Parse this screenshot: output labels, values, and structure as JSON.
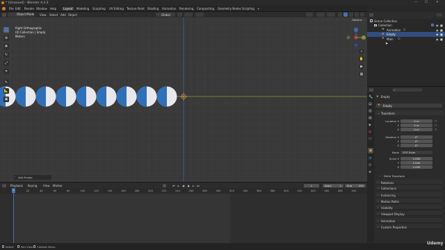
{
  "window": {
    "title": "* (Unsaved) - Blender 4.4.3"
  },
  "menus": [
    "File",
    "Edit",
    "Render",
    "Window",
    "Help"
  ],
  "workspaces": [
    "Layout",
    "Modeling",
    "Sculpting",
    "UV Editing",
    "Texture Paint",
    "Shading",
    "Animation",
    "Rendering",
    "Compositing",
    "Geometry Nodes",
    "Scripting"
  ],
  "active_workspace": "Layout",
  "scene": {
    "scene_name": "Scene",
    "view_layer": "ViewLayer"
  },
  "viewport_header": {
    "mode": "Object Mode",
    "menus": [
      "View",
      "Select",
      "Add",
      "Object"
    ],
    "orientation": "Global",
    "options_label": "Options"
  },
  "viewport_info": {
    "line1": "Right Orthographic",
    "line2": "(0) Collection | Empty",
    "line3": "Meters"
  },
  "last_operator": "Add Empty",
  "outliner": {
    "rows": [
      {
        "label": "Scene Collection",
        "level": 0
      },
      {
        "label": "Collection",
        "level": 1
      },
      {
        "label": "Animation",
        "level": 2
      },
      {
        "label": "Empty",
        "level": 2,
        "selected": true
      },
      {
        "label": "Main",
        "level": 2
      }
    ]
  },
  "properties": {
    "search_placeholder": "",
    "object_name": "Empty",
    "context_name": "Empty",
    "transform_title": "Transform",
    "location_label": "Location X",
    "rotation_label": "Rotation X",
    "scale_label": "Scale X",
    "y_label": "Y",
    "z_label": "Z",
    "location": [
      "0 m",
      "0 m",
      "0 m"
    ],
    "rotation": [
      "0°",
      "0°",
      "0°"
    ],
    "mode_label": "Mode",
    "mode_value": "XYZ Euler",
    "scale": [
      "1.000",
      "1.000",
      "1.000"
    ],
    "delta_label": "Delta Transform",
    "panels": [
      "Relations",
      "Collections",
      "Instancing",
      "Motion Paths",
      "Visibility",
      "Viewport Display",
      "Animation",
      "Custom Properties"
    ]
  },
  "timeline": {
    "menus": [
      "Playback",
      "Keying",
      "View",
      "Marker"
    ],
    "current_frame": "1",
    "start_label": "Start",
    "start": "1",
    "end_label": "End",
    "end": "250",
    "ticks": [
      "1",
      "20",
      "40",
      "60",
      "80",
      "100",
      "120",
      "140",
      "160",
      "180",
      "200",
      "220",
      "240",
      "260",
      "280",
      "300",
      "320",
      "340",
      "360",
      "380",
      "400",
      "420",
      "440",
      "460",
      "480",
      "500"
    ],
    "playhead_label": "1"
  },
  "statusbar": {
    "select": "Select",
    "pan": "Pan View",
    "context": "Context Menu"
  },
  "watermark": "Udemy",
  "colors": {
    "accent": "#4772b3",
    "selected_row": "#334d80",
    "x_axis": "#9a3d3d",
    "y_axis": "#7f9a3b",
    "z_axis": "#3d6bb0",
    "empty": "#e8a050"
  }
}
